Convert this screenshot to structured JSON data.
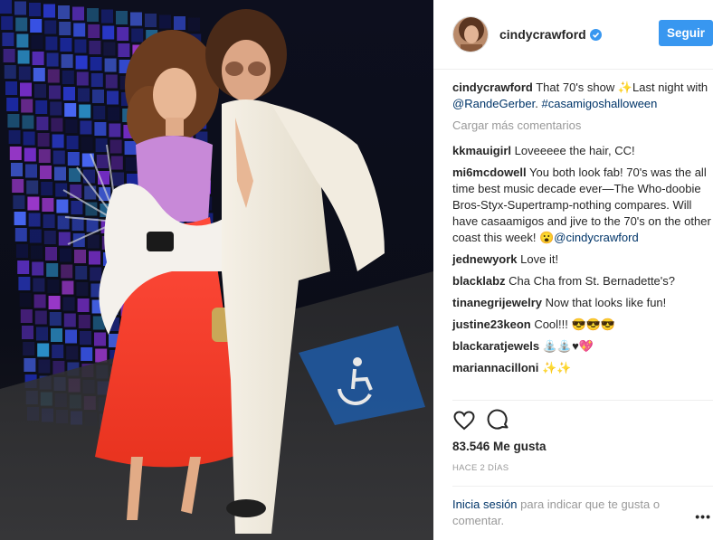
{
  "post": {
    "username": "cindycrawford",
    "follow_label": "Seguir",
    "caption": {
      "user": "cindycrawford",
      "text_before": " That 70's show ✨Last night with ",
      "mention": "@RandeGerber",
      "between": ". ",
      "hashtag": "#casamigoshalloween"
    },
    "load_more": "Cargar más comentarios",
    "comments": [
      {
        "user": "kkmauigirl",
        "text": " Loveeeee the hair, CC!"
      },
      {
        "user": "mi6mcdowell",
        "text": " You both look fab! 70's was the all time best music decade ever—The Who-doobie Bros-Styx-Supertramp-nothing compares. Will have casaamigos and jive to the 70's on the other coast this week! 😮",
        "mention": "@cindycrawford"
      },
      {
        "user": "jednewyork",
        "text": " Love it!"
      },
      {
        "user": "blacklabz",
        "text": " Cha Cha from St. Bernadette's?"
      },
      {
        "user": "tinanegrijewelry",
        "text": " Now that looks like fun!"
      },
      {
        "user": "justine23keon",
        "text": " Cool!!! 😎😎😎"
      },
      {
        "user": "blackaratjewels",
        "text": " ⛲⛲♥💖"
      },
      {
        "user": "mariannacilloni",
        "text": " ✨✨"
      }
    ],
    "likes": "83.546 Me gusta",
    "date": "HACE 2 DÍAS",
    "login_link": "Inicia sesión",
    "login_text": " para indicar que te gusta o comentar.",
    "more_options": "•••"
  },
  "icons": {
    "like": "heart-icon",
    "comment": "comment-icon",
    "verified": "verified-badge-icon",
    "more": "more-options-icon"
  },
  "colors": {
    "accent": "#3897f0",
    "link": "#003569",
    "muted": "#999999",
    "text": "#262626"
  }
}
